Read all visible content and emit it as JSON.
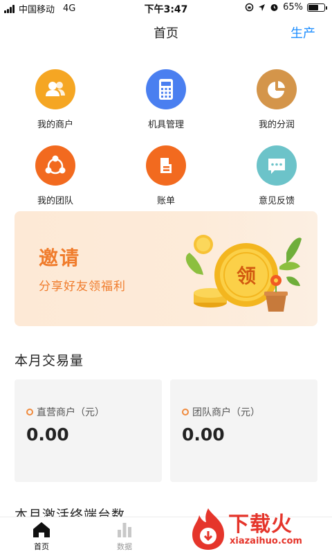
{
  "status_bar": {
    "carrier": "中国移动",
    "network": "4G",
    "time": "下午3:47",
    "battery_text": "65%",
    "battery_level": 0.65
  },
  "nav": {
    "title": "首页",
    "right_action": "生产"
  },
  "menu": [
    {
      "label": "我的商户",
      "icon": "merchants-icon",
      "color": "#f5a623"
    },
    {
      "label": "机具管理",
      "icon": "calculator-icon",
      "color": "#4a7ff0"
    },
    {
      "label": "我的分润",
      "icon": "pie-chart-icon",
      "color": "#d4954a"
    },
    {
      "label": "我的团队",
      "icon": "team-share-icon",
      "color": "#f26a1f"
    },
    {
      "label": "账单",
      "icon": "bill-icon",
      "color": "#f26a1f"
    },
    {
      "label": "意见反馈",
      "icon": "feedback-icon",
      "color": "#6cc3c9"
    }
  ],
  "banner": {
    "title": "邀请",
    "subtitle": "分享好友领福利",
    "coin_text": "领"
  },
  "transactions": {
    "section_title": "本月交易量",
    "cards": [
      {
        "label": "直营商户（元）",
        "value": "0.00"
      },
      {
        "label": "团队商户（元）",
        "value": "0.00"
      }
    ]
  },
  "activations": {
    "section_title": "本月激活终端台数"
  },
  "tabs": [
    {
      "label": "首页",
      "active": true
    },
    {
      "label": "数据",
      "active": false
    }
  ],
  "watermark": {
    "text": "下载火",
    "url": "xiazaihuo.com"
  },
  "colors": {
    "accent_blue": "#1a8cff",
    "accent_orange": "#f07c2c"
  }
}
